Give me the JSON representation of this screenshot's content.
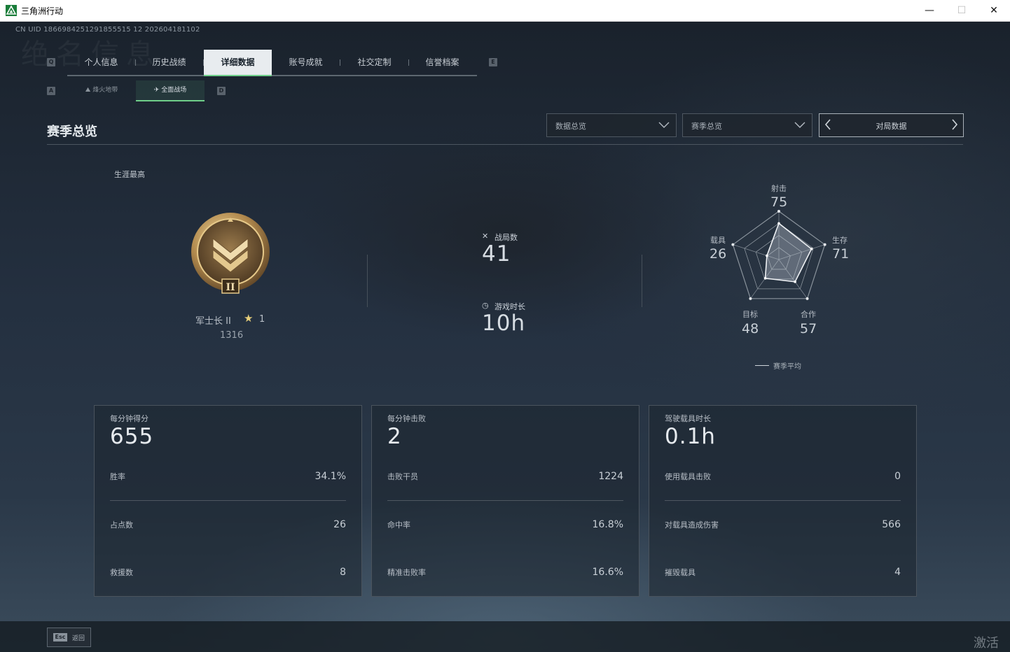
{
  "window": {
    "title": "三角洲行动",
    "min": "—",
    "max": "☐",
    "close": "✕"
  },
  "uid": "CN UID 1866984251291855515 12 202604181102",
  "bg_text": "绝名信息",
  "keys": {
    "tab_left": "Q",
    "tab_right": "E",
    "sub_left": "A",
    "sub_right": "D"
  },
  "tabs": [
    "个人信息",
    "历史战绩",
    "详细数据",
    "账号成就",
    "社交定制",
    "信誉档案"
  ],
  "active_tab": "详细数据",
  "subtabs": [
    "烽火地带",
    "全面战场"
  ],
  "active_subtab": "全面战场",
  "section_title": "赛季总览",
  "dropdowns": {
    "data_view": "数据总览",
    "season": "赛季总览"
  },
  "pager": {
    "label": "对局数据"
  },
  "rank": {
    "career_label": "生涯最高",
    "name": "军士长 II",
    "stars": "1",
    "points": "1316",
    "badge_numeral": "II"
  },
  "summary": {
    "matches_label": "战局数",
    "matches_value": "41",
    "time_label": "游戏时长",
    "time_value": "10h"
  },
  "radar": {
    "axes": [
      {
        "label": "射击",
        "value": 75
      },
      {
        "label": "生存",
        "value": 71
      },
      {
        "label": "合作",
        "value": 57
      },
      {
        "label": "目标",
        "value": 48
      },
      {
        "label": "载具",
        "value": 26
      }
    ],
    "legend": "赛季平均"
  },
  "cards": [
    {
      "head_label": "每分钟得分",
      "head_value": "655",
      "rows": [
        {
          "label": "胜率",
          "value": "34.1%"
        },
        {
          "label": "占点数",
          "value": "26"
        },
        {
          "label": "救援数",
          "value": "8"
        }
      ]
    },
    {
      "head_label": "每分钟击败",
      "head_value": "2",
      "rows": [
        {
          "label": "击败干员",
          "value": "1224"
        },
        {
          "label": "命中率",
          "value": "16.8%"
        },
        {
          "label": "精准击败率",
          "value": "16.6%"
        }
      ]
    },
    {
      "head_label": "驾驶载具时长",
      "head_value": "0.1h",
      "rows": [
        {
          "label": "使用载具击败",
          "value": "0"
        },
        {
          "label": "对载具造成伤害",
          "value": "566"
        },
        {
          "label": "摧毁载具",
          "value": "4"
        }
      ]
    }
  ],
  "footer": {
    "esc_key": "Esc",
    "back_label": "返回",
    "watermark": "激活 V"
  },
  "colors": {
    "accent": "#6fcf8a",
    "gold": "#c9a45a",
    "bg": "#1c2430"
  }
}
